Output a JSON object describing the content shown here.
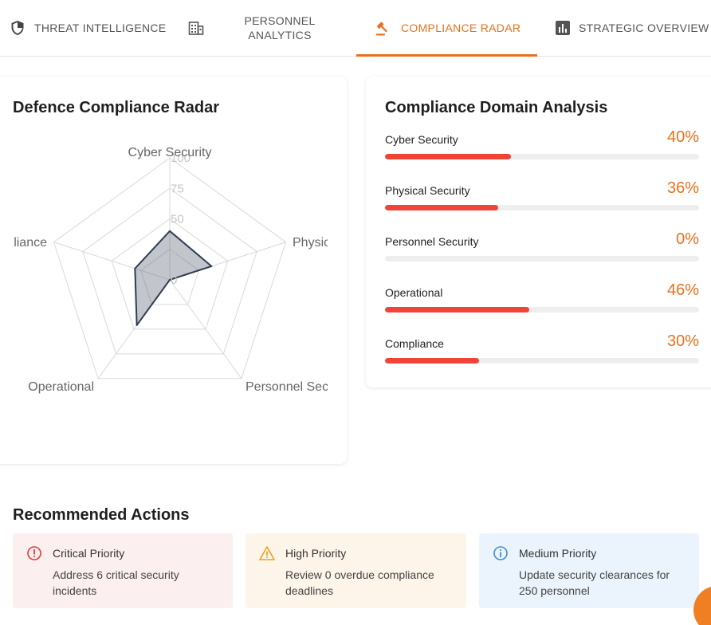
{
  "tabs": [
    {
      "label": "THREAT INTELLIGENCE",
      "icon": "shield-icon",
      "active": false
    },
    {
      "label": "PERSONNEL ANALYTICS",
      "icon": "building-icon",
      "active": false
    },
    {
      "label": "COMPLIANCE RADAR",
      "icon": "gavel-icon",
      "active": true
    },
    {
      "label": "STRATEGIC OVERVIEW",
      "icon": "bar-chart-icon",
      "active": false
    }
  ],
  "accent_color": "#e9711c",
  "bar_color": "#f04438",
  "radar": {
    "title": "Defence Compliance Radar",
    "chart_data": {
      "type": "radar",
      "axes": [
        "Cyber Security",
        "Physical Security",
        "Personnel Security",
        "Operational",
        "Compliance"
      ],
      "axis_labels_shown": [
        "Cyber Security",
        "Physic",
        "Personnel Sec",
        "Operational",
        "liance"
      ],
      "values": [
        40,
        36,
        0,
        46,
        30
      ],
      "scale_ticks": [
        "0",
        "25",
        "50",
        "75",
        "100"
      ],
      "range": [
        0,
        100
      ]
    }
  },
  "domains": {
    "title": "Compliance Domain Analysis",
    "items": [
      {
        "name": "Cyber Security",
        "percent": 40,
        "label": "40%"
      },
      {
        "name": "Physical Security",
        "percent": 36,
        "label": "36%"
      },
      {
        "name": "Personnel Security",
        "percent": 0,
        "label": "0%"
      },
      {
        "name": "Operational",
        "percent": 46,
        "label": "46%"
      },
      {
        "name": "Compliance",
        "percent": 30,
        "label": "30%"
      }
    ]
  },
  "recommendations": {
    "title": "Recommended Actions",
    "items": [
      {
        "priority": "Critical Priority",
        "text": "Address 6 critical security incidents",
        "icon": "alert-circle-icon"
      },
      {
        "priority": "High Priority",
        "text": "Review 0 overdue compliance deadlines",
        "icon": "warning-triangle-icon"
      },
      {
        "priority": "Medium Priority",
        "text": "Update security clearances for 250 personnel",
        "icon": "info-circle-icon"
      }
    ]
  }
}
